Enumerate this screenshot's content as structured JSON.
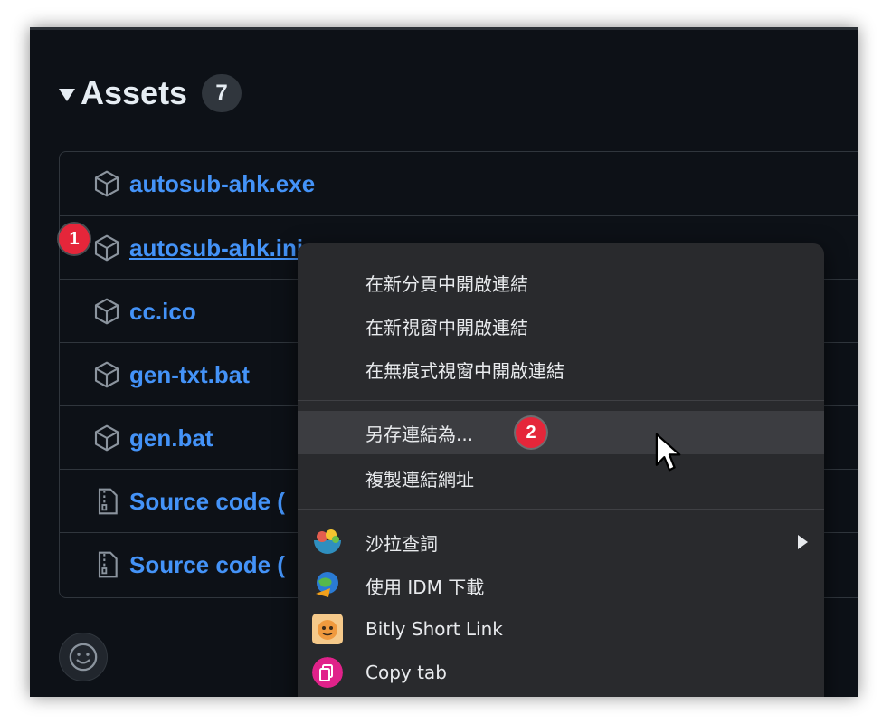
{
  "assets": {
    "title": "Assets",
    "count": "7",
    "items": [
      {
        "label": "autosub-ahk.exe",
        "icon": "package-icon"
      },
      {
        "label": "autosub-ahk.ini",
        "icon": "package-icon",
        "visible_text": "autosub-ahk.i..."
      },
      {
        "label": "cc.ico",
        "icon": "package-icon"
      },
      {
        "label": "gen-txt.bat",
        "icon": "package-icon"
      },
      {
        "label": "gen.bat",
        "icon": "package-icon"
      },
      {
        "label": "Source code (",
        "icon": "file-zip-icon"
      },
      {
        "label": "Source code (",
        "icon": "file-zip-icon"
      }
    ]
  },
  "annotations": {
    "step1": "1",
    "step2": "2"
  },
  "context_menu": {
    "items": [
      {
        "label": "在新分頁中開啟連結"
      },
      {
        "label": "在新視窗中開啟連結"
      },
      {
        "label": "在無痕式視窗中開啟連結"
      },
      {
        "label": "另存連結為..."
      },
      {
        "label": "複製連結網址"
      },
      {
        "label": "沙拉查詞",
        "icon": "salad-icon"
      },
      {
        "label": "使用 IDM 下載",
        "icon": "idm-globe-icon"
      },
      {
        "label": "Bitly Short Link",
        "icon": "bitly-icon"
      },
      {
        "label": "Copy tab",
        "icon": "copy-tab-icon"
      }
    ]
  },
  "colors": {
    "background": "#0d1117",
    "link": "#4493f8",
    "menu": "#292a2d",
    "badge": "#e5263a"
  }
}
